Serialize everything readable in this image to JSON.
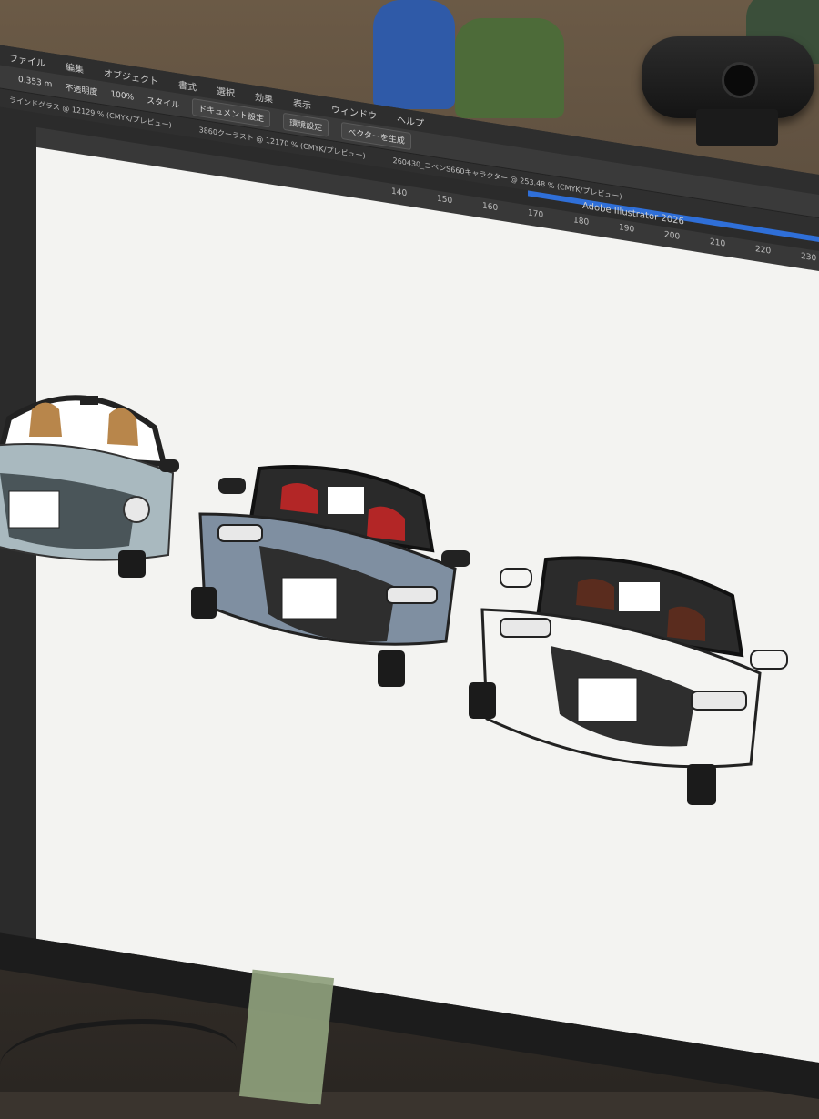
{
  "menu": {
    "items": [
      "ファイル",
      "編集",
      "オブジェクト",
      "書式",
      "選択",
      "効果",
      "表示",
      "ウィンドウ",
      "ヘルプ"
    ]
  },
  "toolbar": {
    "stroke_value": "0.353 m",
    "opacity_label": "不透明度",
    "opacity_value": "100%",
    "style_label": "スタイル",
    "document_settings": "ドキュメント設定",
    "preferences": "環境設定",
    "generate_vector": "ベクターを生成"
  },
  "tabs": [
    "ラインドグラス @ 12129 % (CMYK/プレビュー)",
    "3860クーラスト @ 12170 % (CMYK/プレビュー)",
    "260430_コペンS660キャラクター @ 253.48 % (CMYK/プレビュー)"
  ],
  "app": {
    "title": "Adobe Illustrator 2026"
  },
  "ruler": {
    "ticks": [
      "140",
      "150",
      "160",
      "170",
      "180",
      "190",
      "200",
      "210",
      "220",
      "230"
    ]
  },
  "colors": {
    "car_left_body": "#a9b9bf",
    "car_left_seat": "#b8864b",
    "car_middle_body": "#7f8fa1",
    "car_middle_seat": "#b32626",
    "car_right_body": "#f4f4f2",
    "car_right_seat": "#5a2c1e",
    "illustrator_blue": "#2f6fd8"
  }
}
